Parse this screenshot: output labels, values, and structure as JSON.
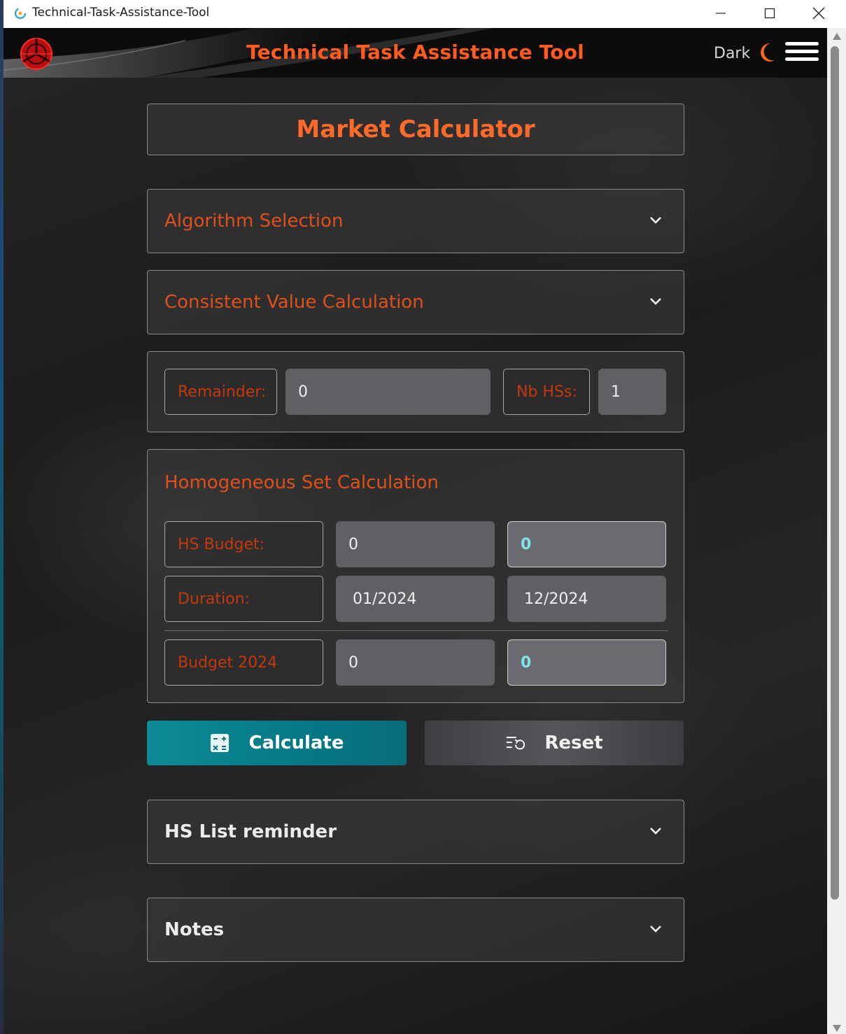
{
  "window": {
    "title": "Technical-Task-Assistance-Tool"
  },
  "header": {
    "title": "Technical Task Assistance Tool",
    "theme_label": "Dark"
  },
  "page": {
    "title": "Market Calculator"
  },
  "sections": {
    "algorithm": {
      "label": "Algorithm Selection"
    },
    "consistent": {
      "label": "Consistent Value Calculation"
    },
    "hs_list": {
      "label": "HS List reminder"
    },
    "notes": {
      "label": "Notes"
    }
  },
  "remainder": {
    "label": "Remainder:",
    "value": "0",
    "nb_label": "Nb HSs:",
    "nb_value": "1"
  },
  "homogeneous": {
    "title": "Homogeneous Set Calculation",
    "hs_budget_label": "HS Budget:",
    "hs_budget_value": "0",
    "hs_budget_result": "0",
    "duration_label": "Duration:",
    "duration_start": "01/2024",
    "duration_end": "12/2024",
    "budget_year_label": "Budget 2024",
    "budget_year_value": "0",
    "budget_year_result": "0"
  },
  "actions": {
    "calculate": "Calculate",
    "reset": "Reset"
  },
  "colors": {
    "accent_orange": "#ff5a1f",
    "label_red": "#c4380c",
    "teal_button": "#067886",
    "highlight_value": "#7fe3e8"
  }
}
